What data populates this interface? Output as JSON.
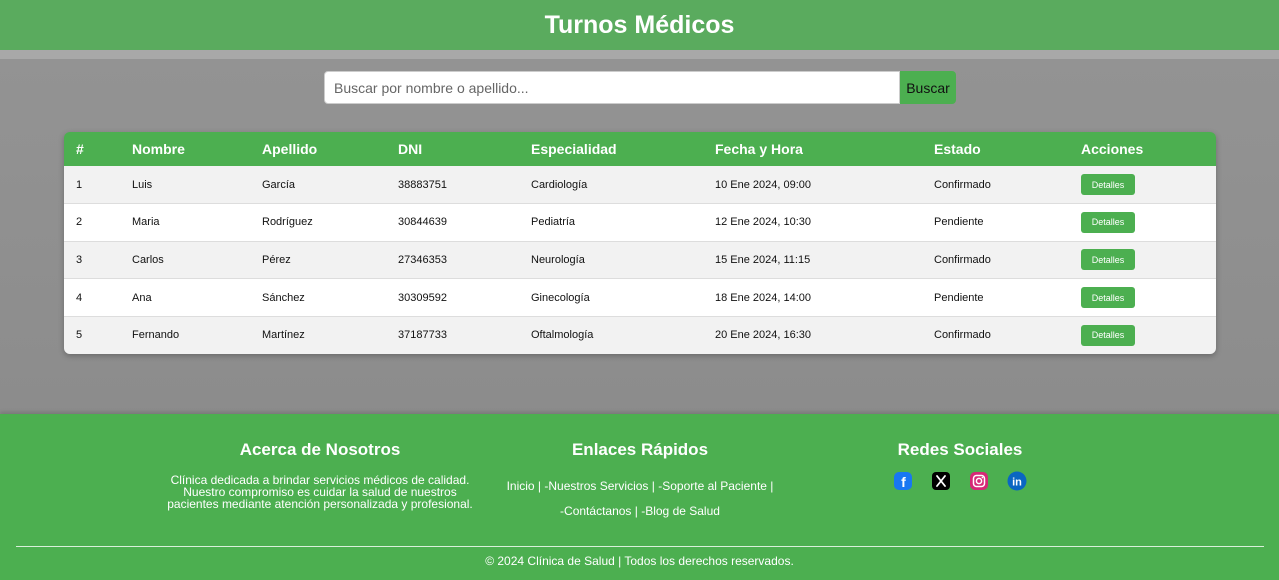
{
  "header": {
    "title": "Turnos Médicos"
  },
  "search": {
    "placeholder": "Buscar por nombre o apellido...",
    "button_label": "Buscar"
  },
  "table": {
    "columns": [
      "#",
      "Nombre",
      "Apellido",
      "DNI",
      "Especialidad",
      "Fecha y Hora",
      "Estado",
      "Acciones"
    ],
    "rows": [
      {
        "num": "1",
        "nombre": "Luis",
        "apellido": "García",
        "dni": "38883751",
        "especialidad": "Cardiología",
        "fecha": "10 Ene 2024, 09:00",
        "estado": "Confirmado",
        "accion": "Detalles"
      },
      {
        "num": "2",
        "nombre": "Maria",
        "apellido": "Rodríguez",
        "dni": "30844639",
        "especialidad": "Pediatría",
        "fecha": "12 Ene 2024, 10:30",
        "estado": "Pendiente",
        "accion": "Detalles"
      },
      {
        "num": "3",
        "nombre": "Carlos",
        "apellido": "Pérez",
        "dni": "27346353",
        "especialidad": "Neurología",
        "fecha": "15 Ene 2024, 11:15",
        "estado": "Confirmado",
        "accion": "Detalles"
      },
      {
        "num": "4",
        "nombre": "Ana",
        "apellido": "Sánchez",
        "dni": "30309592",
        "especialidad": "Ginecología",
        "fecha": "18 Ene 2024, 14:00",
        "estado": "Pendiente",
        "accion": "Detalles"
      },
      {
        "num": "5",
        "nombre": "Fernando",
        "apellido": "Martínez",
        "dni": "37187733",
        "especialidad": "Oftalmología",
        "fecha": "20 Ene 2024, 16:30",
        "estado": "Confirmado",
        "accion": "Detalles"
      }
    ]
  },
  "footer": {
    "about": {
      "title": "Acerca de Nosotros",
      "text": "Clínica dedicada a brindar servicios médicos de calidad. Nuestro compromiso es cuidar la salud de nuestros pacientes mediante atención personalizada y profesional."
    },
    "links": {
      "title": "Enlaces Rápidos",
      "items": [
        "Inicio |",
        "-Nuestros Servicios |",
        "-Soporte al Paciente |",
        "-Contáctanos |",
        "-Blog de Salud"
      ]
    },
    "social": {
      "title": "Redes Sociales",
      "icons": [
        "facebook-icon",
        "x-icon",
        "instagram-icon",
        "linkedin-icon"
      ]
    },
    "copyright": "© 2024 Clínica de Salud | Todos los derechos reservados."
  },
  "colors": {
    "accent": "#4caf50",
    "header": "#5aab5e",
    "background": "#8f8f8f"
  }
}
